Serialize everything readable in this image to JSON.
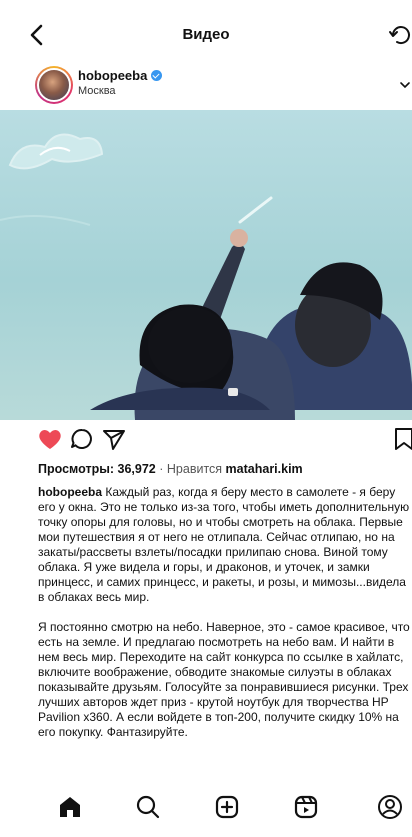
{
  "header": {
    "title": "Видео",
    "back_icon": "chevron-left-icon",
    "refresh_icon": "refresh-icon"
  },
  "post": {
    "username": "hobopeeba",
    "verified": true,
    "location": "Москва",
    "more_icon": "chevron-down-icon"
  },
  "actions": {
    "like_icon": "heart-filled-icon",
    "like_color": "#ed4956",
    "comment_icon": "comment-icon",
    "share_icon": "send-icon",
    "save_icon": "bookmark-icon"
  },
  "stats": {
    "views_label": "Просмотры: 36,972",
    "separator": "·",
    "liked_prefix": "Нравится",
    "liked_user": "matahari.kim"
  },
  "caption": {
    "username": "hobopeeba",
    "paragraph1": "Каждый раз, когда я беру место в самолете - я беру его у окна. Это не только из-за того, чтобы иметь дополнительную точку опоры для головы, но и чтобы смотреть на облака. Первые мои путешествия я от него не отлипала. Сейчас отлипаю, но на закаты/рассветы взлеты/посадки прилипаю снова. Виной тому облака. Я уже видела и горы, и драконов, и уточек, и замки принцесс, и самих принцесс, и ракеты, и розы, и мимозы...видела в облаках весь мир.",
    "paragraph2": "Я постоянно смотрю на небо. Наверное, это - самое красивое, что есть на земле. И предлагаю посмотреть на небо вам. И найти в нем весь мир. Переходите на сайт конкурса по ссылке в хайлатс, включите воображение, обводите знакомые силуэты в облаках показывайте друзьям. Голосуйте за понравившиеся рисунки. Трех лучших авторов ждет приз - крутой ноутбук для творчества HP Pavilion x360. А если войдете в топ-200, получите скидку 10% на его покупку. Фантазируйте."
  },
  "bottom_nav": {
    "items": [
      "home-icon",
      "search-icon",
      "create-icon",
      "reels-icon",
      "profile-icon"
    ],
    "active": "home-icon"
  }
}
